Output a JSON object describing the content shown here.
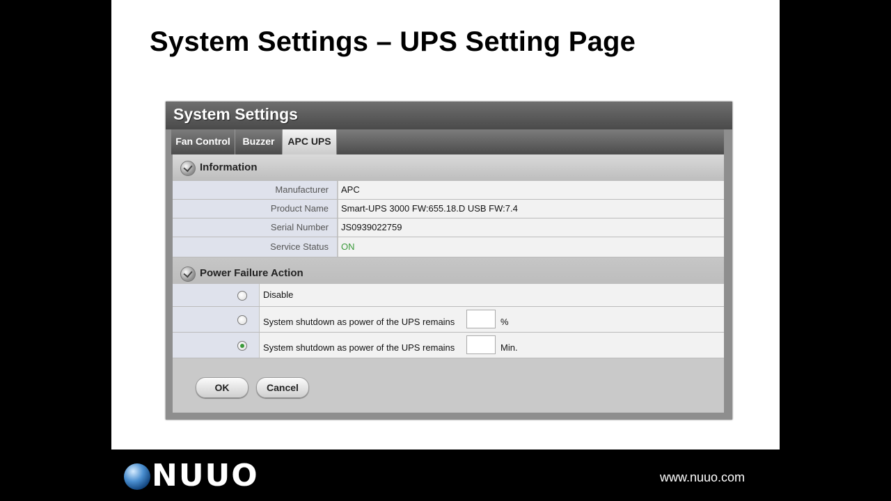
{
  "slide": {
    "title": "System Settings – UPS Setting Page"
  },
  "panel": {
    "title": "System Settings",
    "tabs": [
      {
        "label": "Fan Control",
        "active": false
      },
      {
        "label": "Buzzer",
        "active": false
      },
      {
        "label": "APC UPS",
        "active": true
      }
    ]
  },
  "information": {
    "title": "Information",
    "icon": "checkmark-icon",
    "rows": [
      {
        "label": "Manufacturer",
        "value": "APC"
      },
      {
        "label": "Product Name",
        "value": "Smart-UPS 3000 FW:655.18.D USB FW:7.4"
      },
      {
        "label": "Serial Number",
        "value": "JS0939022759"
      },
      {
        "label": "Service Status",
        "value": "ON"
      }
    ]
  },
  "power_failure": {
    "title": "Power Failure Action",
    "icon": "checkmark-icon",
    "options": [
      {
        "label": "Disable",
        "checked": false
      },
      {
        "label": "System shutdown as power of the UPS remains",
        "input_value": "",
        "unit": "%",
        "checked": false
      },
      {
        "label": "System shutdown as power of the UPS remains",
        "input_value": "",
        "unit": "Min.",
        "checked": true
      }
    ]
  },
  "buttons": {
    "ok": "OK",
    "cancel": "Cancel"
  },
  "footer": {
    "logo_text": "NUUO",
    "website": "www.nuuo.com"
  },
  "colors": {
    "status_on": "#3a9a3a",
    "panel_header": "#5a5a5a",
    "slide_bg": "#ffffff",
    "frame_bg": "#000000"
  }
}
